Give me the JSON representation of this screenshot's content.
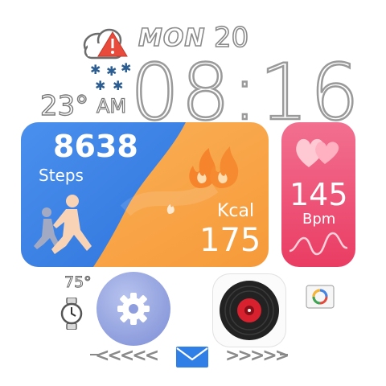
{
  "header": {
    "day": "MON",
    "date": "20",
    "temperature": "23°",
    "ampm": "AM",
    "time": "08:16",
    "weather_icon": "cloud-snow-warning-icon"
  },
  "activity": {
    "steps_value": "8638",
    "steps_label": "Steps",
    "kcal_label": "Kcal",
    "kcal_value": "175",
    "colors": {
      "steps_bg": "#3d86ea",
      "kcal_bg": "#f9a64b"
    }
  },
  "heart_rate": {
    "value": "145",
    "unit": "Bpm",
    "color": "#ea3c63"
  },
  "bottom": {
    "battery_temp": "75°",
    "swipe_left": "<<<<<",
    "swipe_right": ">>>>>",
    "icons": [
      "watch-icon",
      "settings-icon",
      "music-record-icon",
      "photo-icon",
      "mail-icon"
    ]
  }
}
